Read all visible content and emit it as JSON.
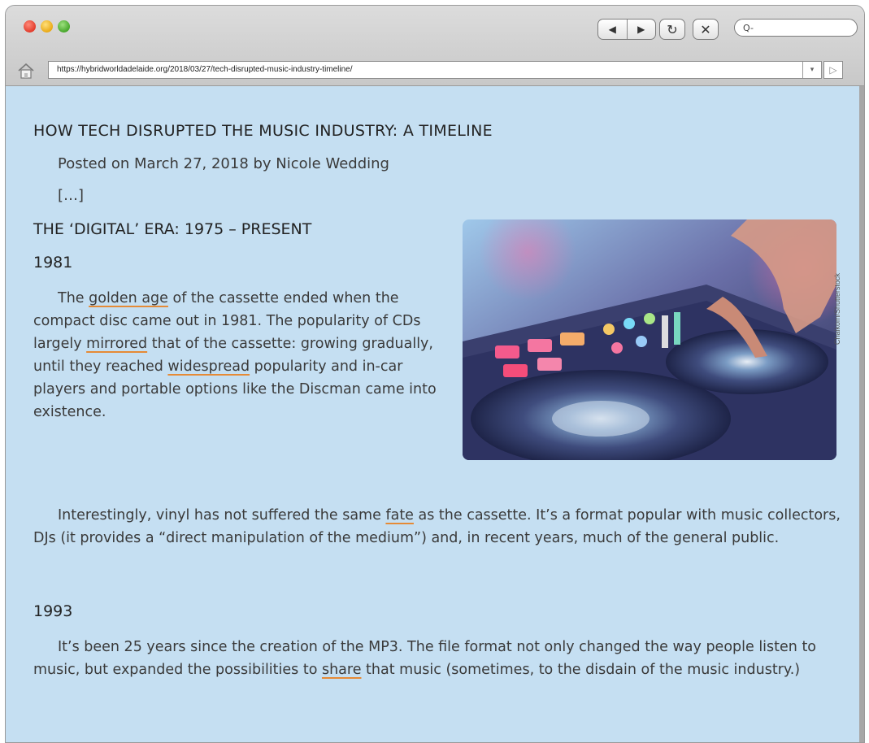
{
  "browser": {
    "url": "https://hybridworldadelaide.org/2018/03/27/tech-disrupted-music-industry-timeline/",
    "nav_back": "◀",
    "nav_forward": "▶",
    "reload": "↻",
    "stop": "✕",
    "search_prompt": "Q-",
    "dropdown": "▾",
    "go": "▷"
  },
  "article": {
    "title": "HOW TECH DISRUPTED THE MUSIC INDUSTRY: A TIMELINE",
    "meta": "Posted on March 27, 2018 by Nicole Wedding",
    "ellipsis": "[…]",
    "section_heading": "THE ‘DIGITAL’ ERA: 1975 – PRESENT",
    "year_1981": "1981",
    "p1": {
      "a": "The ",
      "u1": "golden age",
      "b": " of the cassette ended when the compact disc came out in 1981. The popularity of CDs largely ",
      "u2": "mirrored",
      "c": " that of the cassette: growing gradually, until they reached ",
      "u3": "widespread",
      "d": " popularity and in-car players and portable options like the Discman came into existence."
    },
    "p2": {
      "a": "Interestingly, vinyl has not suffered the same ",
      "u1": "fate",
      "b": " as the cassette. It’s a format popular with music collectors, DJs (it provides a “direct manipulation of the medium”) and, in recent years, much of the general public."
    },
    "year_1993": "1993",
    "p3": {
      "a": "It’s been 25 years since the creation of the MP3. The file format not only changed the way people listen to music, but expanded the possibilities to ",
      "u1": "share",
      "b": " that music (sometimes, to the disdain of the music industry.)"
    },
    "photo_credit": "Chaikom/Shutterstock"
  },
  "colors": {
    "page_bg": "#c5dff2",
    "underline_accent": "#e58a36"
  }
}
